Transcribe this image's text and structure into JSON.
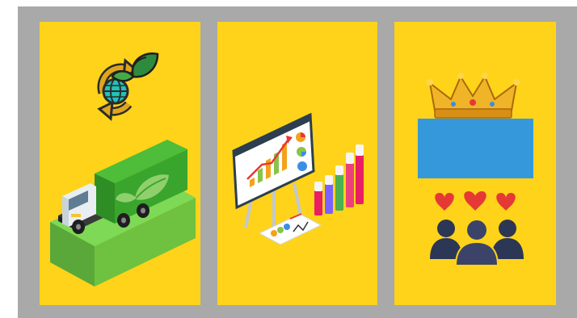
{
  "background_color": "#a9a9a9",
  "panel_color": "#ffd31a",
  "panels": [
    {
      "icons": [
        "recycle-globe-leaf-icon",
        "green-delivery-truck-icon"
      ]
    },
    {
      "icons": [
        "presentation-board-chart-icon",
        "bar-graph-icon",
        "report-sheet-icon"
      ]
    },
    {
      "icons": [
        "crown-icon",
        "customers-hearts-icon"
      ],
      "box_color": "#3498db"
    }
  ]
}
